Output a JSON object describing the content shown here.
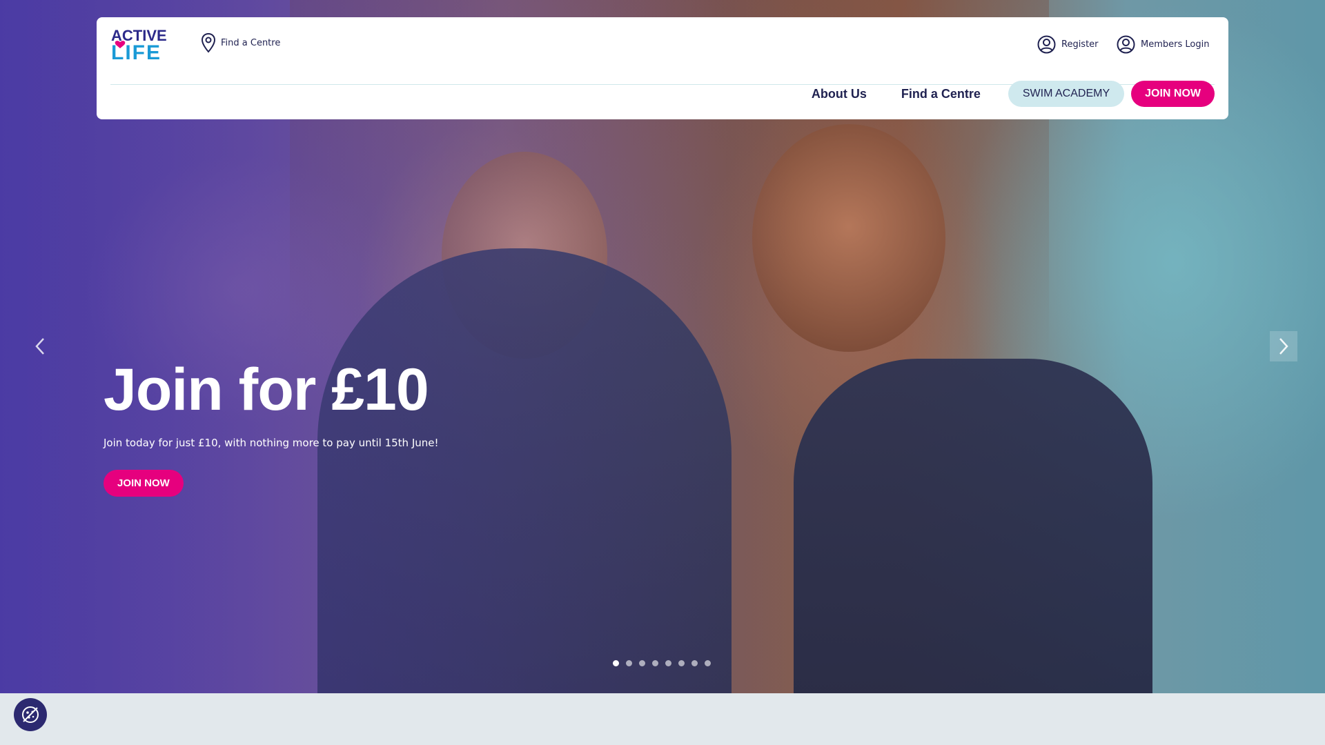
{
  "header": {
    "logo": {
      "line1": "ACTIVE",
      "line2": "LIFE"
    },
    "find_centre_top": "Find a Centre",
    "register": "Register",
    "members_login": "Members Login"
  },
  "nav": {
    "about": "About Us",
    "find_centre": "Find a Centre",
    "swim_academy": "SWIM ACADEMY",
    "join_now": "JOIN NOW"
  },
  "hero": {
    "title": "Join for £10",
    "subtitle": "Join today for just £10, with nothing more to pay until 15th June!",
    "cta": "JOIN NOW",
    "slide_count": 8,
    "active_slide": 1
  },
  "colors": {
    "brand_navy": "#1f2150",
    "brand_pink": "#e6007e",
    "brand_blue": "#1a9ad6",
    "swim_bg": "#cfe9ee"
  },
  "icons": {
    "location": "location-pin-icon",
    "user": "user-circle-icon",
    "prev": "chevron-left-icon",
    "next": "chevron-right-icon",
    "cookie": "cookie-icon"
  }
}
